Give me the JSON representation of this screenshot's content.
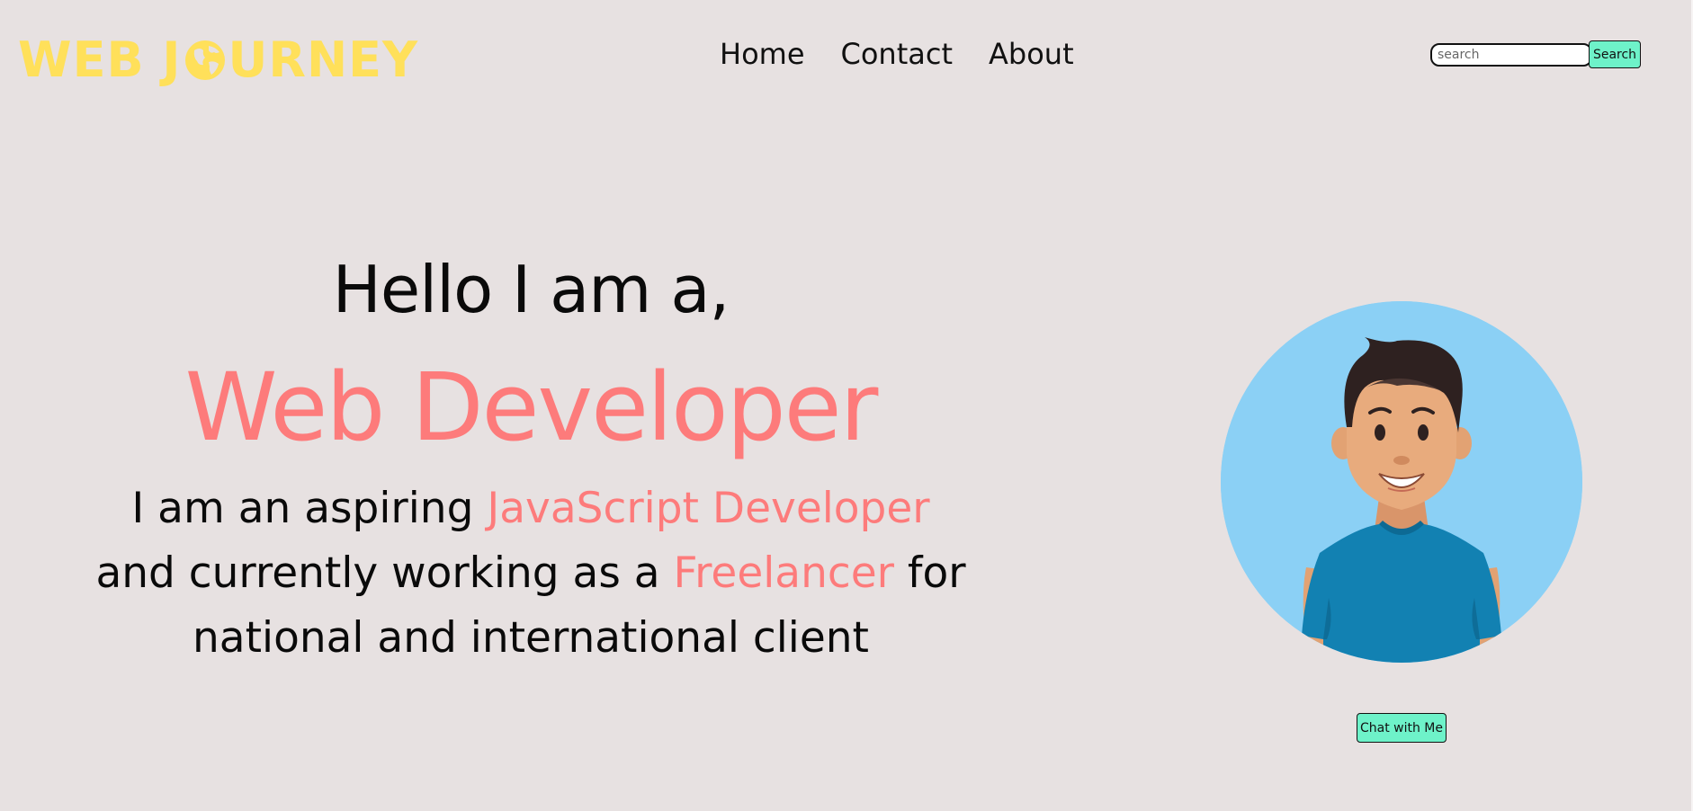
{
  "header": {
    "logo": {
      "text_before": "WEB J",
      "text_after": "URNEY",
      "color": "#ffe05a"
    },
    "nav": [
      {
        "label": "Home"
      },
      {
        "label": "Contact"
      },
      {
        "label": "About"
      }
    ],
    "search": {
      "placeholder": "search",
      "button_label": "Search"
    }
  },
  "hero": {
    "greeting": "Hello I am a,",
    "title": "Web Developer",
    "description": {
      "part1": "I am an aspiring ",
      "highlight1": "JavaScript Developer",
      "part2": "and currently working as a ",
      "highlight2": "Freelancer",
      "part3": " for",
      "part4": "national and international client"
    }
  },
  "chat": {
    "button_label": "Chat with Me"
  },
  "colors": {
    "background": "#e7e1e1",
    "accent": "#fd7b7b",
    "logo": "#ffe05a",
    "button": "#6ef2c9",
    "avatar_bg": "#8bd0f5"
  },
  "icons": {
    "logo_globe": "globe-icon",
    "avatar": "developer-avatar"
  }
}
